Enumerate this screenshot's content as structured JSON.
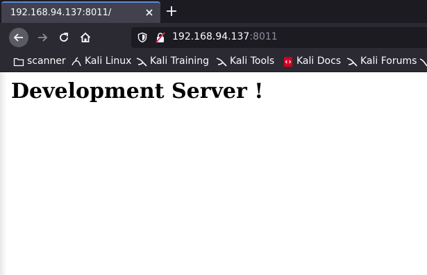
{
  "tab": {
    "title": "192.168.94.137:8011/"
  },
  "urlbar": {
    "host": "192.168.94.137",
    "port": ":8011"
  },
  "bookmarks": [
    {
      "label": "scanner",
      "icon": "folder-icon"
    },
    {
      "label": "Kali Linux",
      "icon": "kali-dragon-icon"
    },
    {
      "label": "Kali Training",
      "icon": "kali-dragon-icon"
    },
    {
      "label": "Kali Tools",
      "icon": "kali-dragon-icon"
    },
    {
      "label": "Kali Docs",
      "icon": "kali-docs-icon"
    },
    {
      "label": "Kali Forums",
      "icon": "kali-dragon-icon"
    }
  ],
  "page": {
    "heading": "Development Server !"
  },
  "colors": {
    "accent": "#5b8dd9",
    "chrome": "#2b2a33",
    "tabstrip": "#1c1b22",
    "docs_red": "#d70022"
  }
}
